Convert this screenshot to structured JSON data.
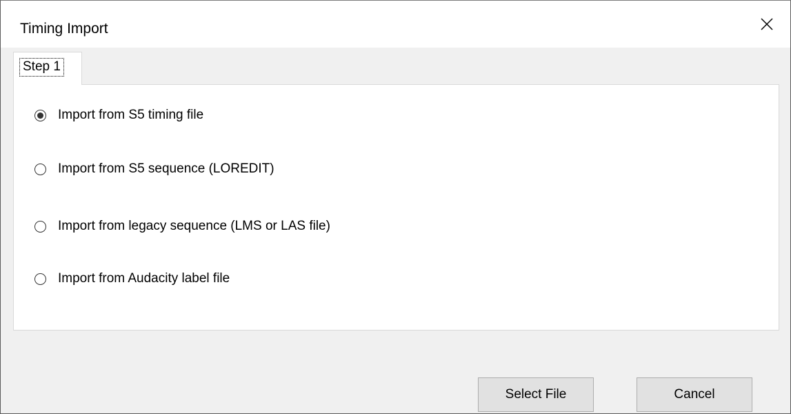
{
  "window": {
    "title": "Timing Import",
    "close_icon": "close-icon"
  },
  "tabs": [
    {
      "label": "Step 1",
      "selected": true
    }
  ],
  "import_options": [
    {
      "label": "Import from S5 timing file",
      "selected": true
    },
    {
      "label": "Import from S5 sequence (LOREDIT)",
      "selected": false
    },
    {
      "label": "Import from legacy sequence (LMS or LAS file)",
      "selected": false
    },
    {
      "label": "Import from Audacity label file",
      "selected": false
    }
  ],
  "buttons": {
    "select_file": "Select File",
    "cancel": "Cancel"
  }
}
